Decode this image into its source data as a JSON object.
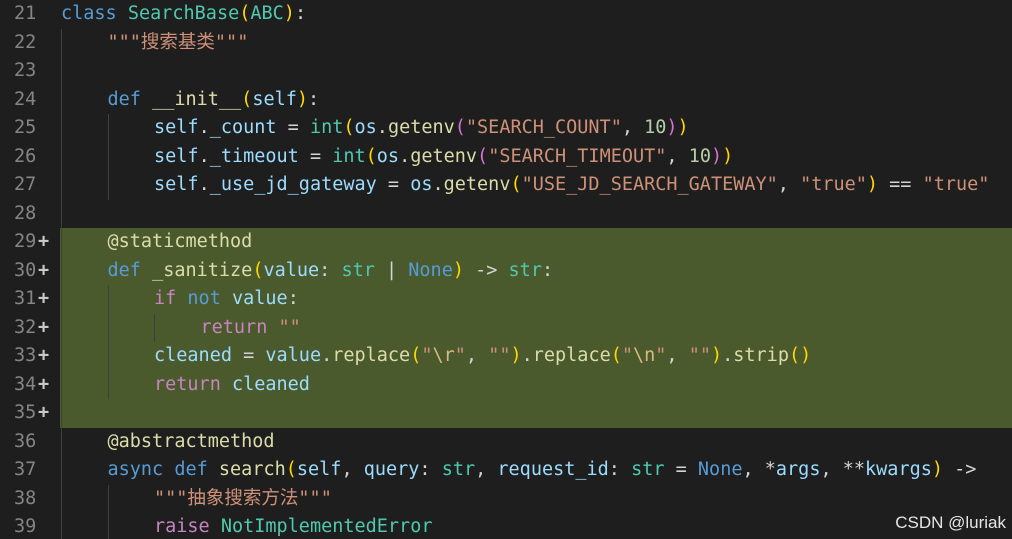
{
  "lines": [
    {
      "num": "21",
      "mark": "",
      "added": false,
      "indent": 0,
      "tokens": [
        [
          "kw",
          "class"
        ],
        [
          "tx",
          " "
        ],
        [
          "cls",
          "SearchBase"
        ],
        [
          "bk",
          "("
        ],
        [
          "cls",
          "ABC"
        ],
        [
          "bk",
          ")"
        ],
        [
          "tx",
          ":"
        ]
      ]
    },
    {
      "num": "22",
      "mark": "",
      "added": false,
      "indent": 1,
      "tokens": [
        [
          "str",
          "\"\"\"搜索基类\"\"\""
        ]
      ]
    },
    {
      "num": "23",
      "mark": "",
      "added": false,
      "indent": 1,
      "tokens": []
    },
    {
      "num": "24",
      "mark": "",
      "added": false,
      "indent": 1,
      "tokens": [
        [
          "kw",
          "def"
        ],
        [
          "tx",
          " "
        ],
        [
          "fn",
          "__init__"
        ],
        [
          "bk",
          "("
        ],
        [
          "self",
          "self"
        ],
        [
          "bk",
          ")"
        ],
        [
          "tx",
          ":"
        ]
      ]
    },
    {
      "num": "25",
      "mark": "",
      "added": false,
      "indent": 2,
      "tokens": [
        [
          "self",
          "self"
        ],
        [
          "tx",
          "."
        ],
        [
          "var",
          "_count"
        ],
        [
          "tx",
          " = "
        ],
        [
          "cls",
          "int"
        ],
        [
          "bk",
          "("
        ],
        [
          "var",
          "os"
        ],
        [
          "tx",
          "."
        ],
        [
          "fn",
          "getenv"
        ],
        [
          "bk2",
          "("
        ],
        [
          "str",
          "\"SEARCH_COUNT\""
        ],
        [
          "tx",
          ", "
        ],
        [
          "num",
          "10"
        ],
        [
          "bk2",
          ")"
        ],
        [
          "bk",
          ")"
        ]
      ]
    },
    {
      "num": "26",
      "mark": "",
      "added": false,
      "indent": 2,
      "tokens": [
        [
          "self",
          "self"
        ],
        [
          "tx",
          "."
        ],
        [
          "var",
          "_timeout"
        ],
        [
          "tx",
          " = "
        ],
        [
          "cls",
          "int"
        ],
        [
          "bk",
          "("
        ],
        [
          "var",
          "os"
        ],
        [
          "tx",
          "."
        ],
        [
          "fn",
          "getenv"
        ],
        [
          "bk2",
          "("
        ],
        [
          "str",
          "\"SEARCH_TIMEOUT\""
        ],
        [
          "tx",
          ", "
        ],
        [
          "num",
          "10"
        ],
        [
          "bk2",
          ")"
        ],
        [
          "bk",
          ")"
        ]
      ]
    },
    {
      "num": "27",
      "mark": "",
      "added": false,
      "indent": 2,
      "tokens": [
        [
          "self",
          "self"
        ],
        [
          "tx",
          "."
        ],
        [
          "var",
          "_use_jd_gateway"
        ],
        [
          "tx",
          " = "
        ],
        [
          "var",
          "os"
        ],
        [
          "tx",
          "."
        ],
        [
          "fn",
          "getenv"
        ],
        [
          "bk",
          "("
        ],
        [
          "str",
          "\"USE_JD_SEARCH_GATEWAY\""
        ],
        [
          "tx",
          ", "
        ],
        [
          "str",
          "\"true\""
        ],
        [
          "bk",
          ")"
        ],
        [
          "tx",
          " == "
        ],
        [
          "str",
          "\"true\""
        ]
      ]
    },
    {
      "num": "28",
      "mark": "",
      "added": false,
      "indent": 1,
      "tokens": []
    },
    {
      "num": "29",
      "mark": "+",
      "added": true,
      "indent": 1,
      "tokens": [
        [
          "dec",
          "@staticmethod"
        ]
      ]
    },
    {
      "num": "30",
      "mark": "+",
      "added": true,
      "indent": 1,
      "tokens": [
        [
          "kw",
          "def"
        ],
        [
          "tx",
          " "
        ],
        [
          "fn",
          "_sanitize"
        ],
        [
          "bk",
          "("
        ],
        [
          "var",
          "value"
        ],
        [
          "tx",
          ": "
        ],
        [
          "cls",
          "str"
        ],
        [
          "tx",
          " | "
        ],
        [
          "const",
          "None"
        ],
        [
          "bk",
          ")"
        ],
        [
          "tx",
          " -> "
        ],
        [
          "cls",
          "str"
        ],
        [
          "tx",
          ":"
        ]
      ]
    },
    {
      "num": "31",
      "mark": "+",
      "added": true,
      "indent": 2,
      "tokens": [
        [
          "ctl",
          "if"
        ],
        [
          "tx",
          " "
        ],
        [
          "kw",
          "not"
        ],
        [
          "tx",
          " "
        ],
        [
          "var",
          "value"
        ],
        [
          "tx",
          ":"
        ]
      ]
    },
    {
      "num": "32",
      "mark": "+",
      "added": true,
      "indent": 3,
      "tokens": [
        [
          "ctl",
          "return"
        ],
        [
          "tx",
          " "
        ],
        [
          "str",
          "\"\""
        ]
      ]
    },
    {
      "num": "33",
      "mark": "+",
      "added": true,
      "indent": 2,
      "tokens": [
        [
          "var",
          "cleaned"
        ],
        [
          "tx",
          " = "
        ],
        [
          "var",
          "value"
        ],
        [
          "tx",
          "."
        ],
        [
          "fn",
          "replace"
        ],
        [
          "bk",
          "("
        ],
        [
          "str",
          "\""
        ],
        [
          "esc",
          "\\r"
        ],
        [
          "str",
          "\""
        ],
        [
          "tx",
          ", "
        ],
        [
          "str",
          "\"\""
        ],
        [
          "bk",
          ")"
        ],
        [
          "tx",
          "."
        ],
        [
          "fn",
          "replace"
        ],
        [
          "bk",
          "("
        ],
        [
          "str",
          "\""
        ],
        [
          "esc",
          "\\n"
        ],
        [
          "str",
          "\""
        ],
        [
          "tx",
          ", "
        ],
        [
          "str",
          "\"\""
        ],
        [
          "bk",
          ")"
        ],
        [
          "tx",
          "."
        ],
        [
          "fn",
          "strip"
        ],
        [
          "bk",
          "()"
        ]
      ]
    },
    {
      "num": "34",
      "mark": "+",
      "added": true,
      "indent": 2,
      "tokens": [
        [
          "ctl",
          "return"
        ],
        [
          "tx",
          " "
        ],
        [
          "var",
          "cleaned"
        ]
      ]
    },
    {
      "num": "35",
      "mark": "+",
      "added": true,
      "indent": 1,
      "tokens": []
    },
    {
      "num": "36",
      "mark": "",
      "added": false,
      "indent": 1,
      "tokens": [
        [
          "dec",
          "@abstractmethod"
        ]
      ]
    },
    {
      "num": "37",
      "mark": "",
      "added": false,
      "indent": 1,
      "tokens": [
        [
          "kw",
          "async"
        ],
        [
          "tx",
          " "
        ],
        [
          "kw",
          "def"
        ],
        [
          "tx",
          " "
        ],
        [
          "fn",
          "search"
        ],
        [
          "bk",
          "("
        ],
        [
          "self",
          "self"
        ],
        [
          "tx",
          ", "
        ],
        [
          "var",
          "query"
        ],
        [
          "tx",
          ": "
        ],
        [
          "cls",
          "str"
        ],
        [
          "tx",
          ", "
        ],
        [
          "var",
          "request_id"
        ],
        [
          "tx",
          ": "
        ],
        [
          "cls",
          "str"
        ],
        [
          "tx",
          " = "
        ],
        [
          "const",
          "None"
        ],
        [
          "tx",
          ", *"
        ],
        [
          "var",
          "args"
        ],
        [
          "tx",
          ", **"
        ],
        [
          "var",
          "kwargs"
        ],
        [
          "bk",
          ")"
        ],
        [
          "tx",
          " ->"
        ]
      ]
    },
    {
      "num": "38",
      "mark": "",
      "added": false,
      "indent": 2,
      "tokens": [
        [
          "str",
          "\"\"\"抽象搜索方法\"\"\""
        ]
      ]
    },
    {
      "num": "39",
      "mark": "",
      "added": false,
      "indent": 2,
      "tokens": [
        [
          "ctl",
          "raise"
        ],
        [
          "tx",
          " "
        ],
        [
          "cls",
          "NotImplementedError"
        ]
      ]
    }
  ],
  "watermark": "CSDN @luriak",
  "colors": {
    "background": "#1e1e1e",
    "added_line": "#4b5a2c",
    "line_number": "#858585"
  }
}
